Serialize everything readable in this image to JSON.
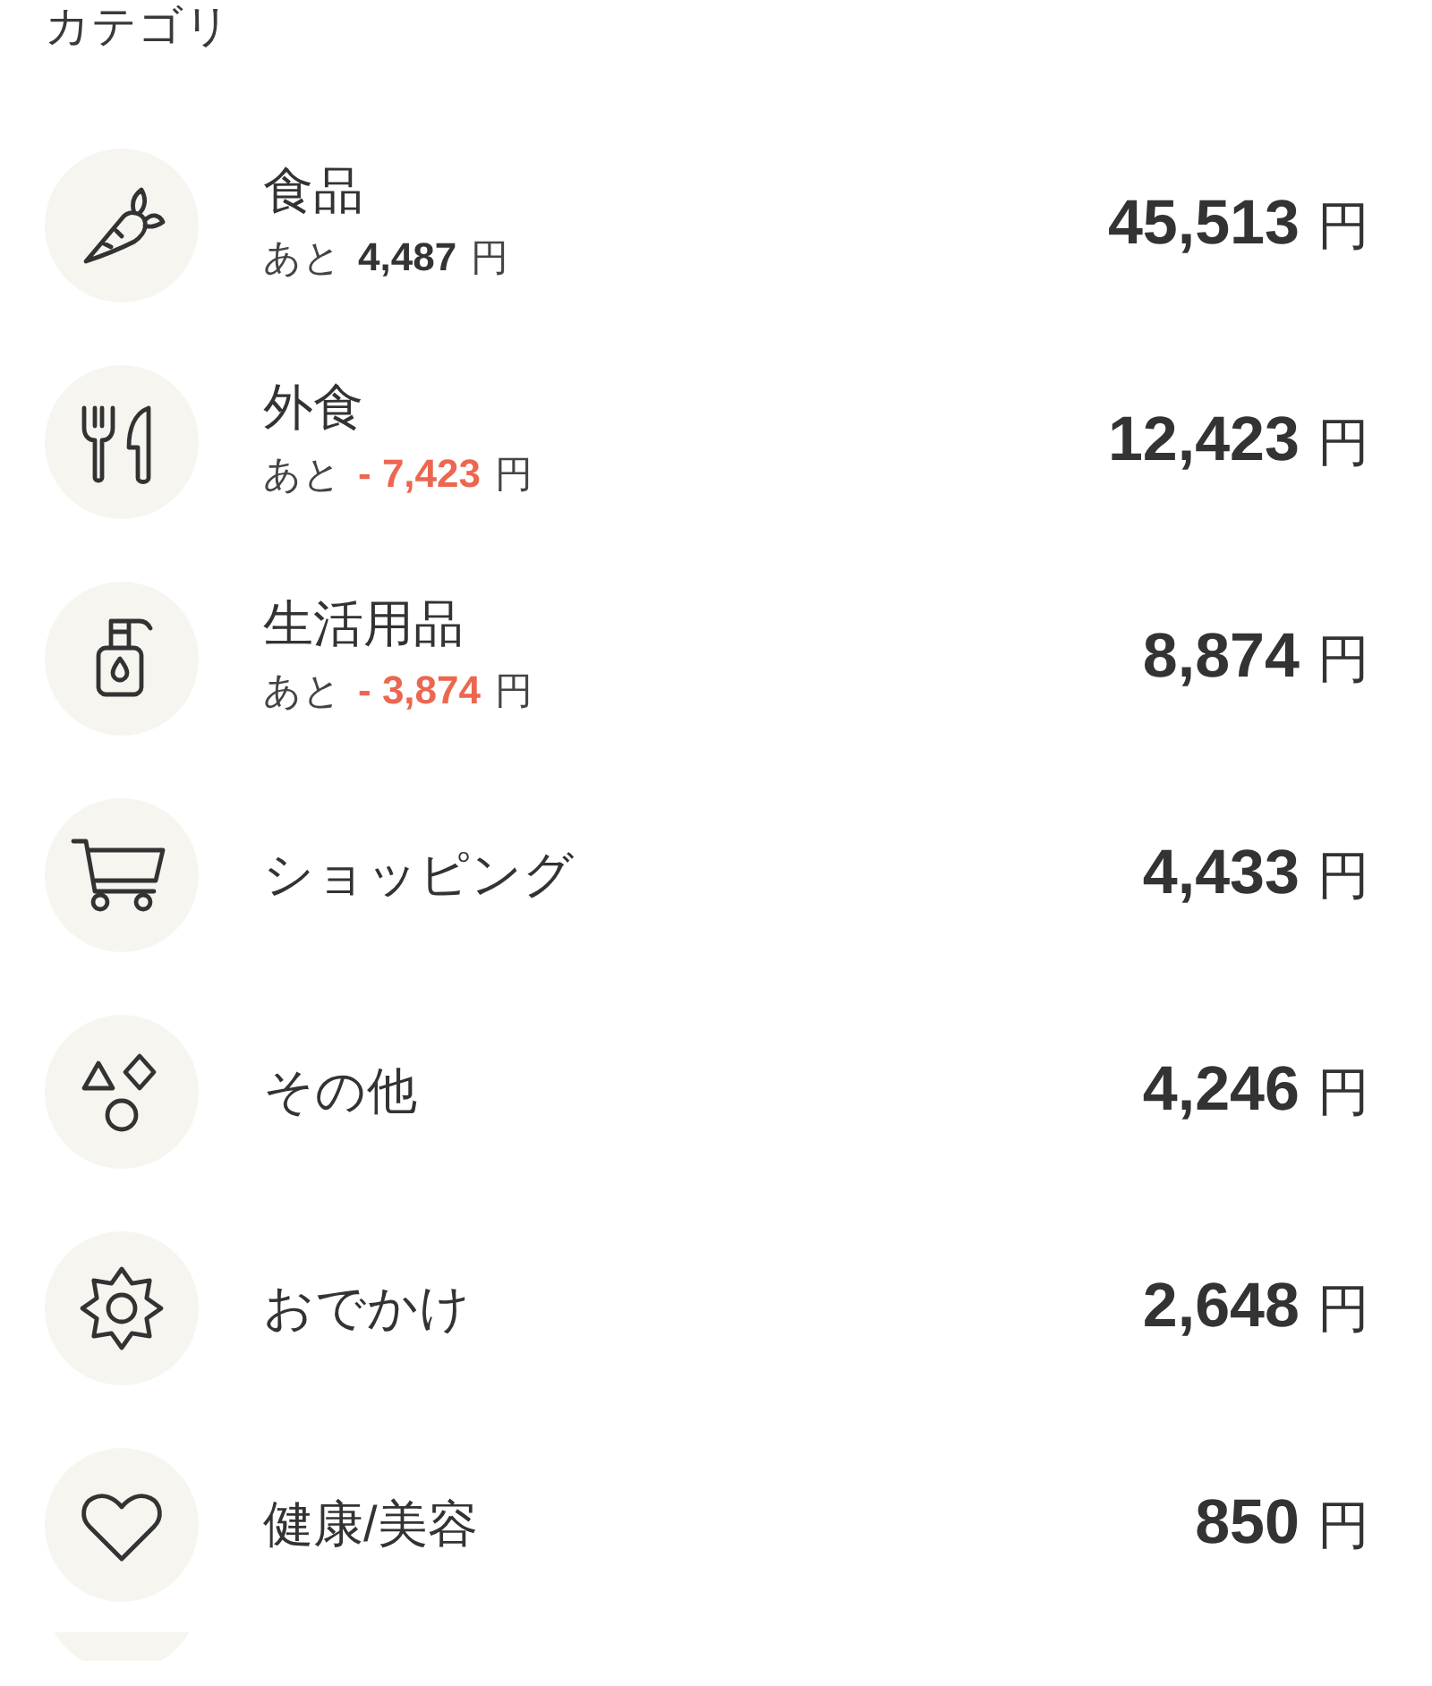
{
  "header": {
    "title": "カテゴリ"
  },
  "categories": [
    {
      "name": "食品",
      "amount": "45,513",
      "unit": "円",
      "remaining": {
        "label": "あと",
        "amount": "4,487",
        "unit": "円",
        "over": false
      }
    },
    {
      "name": "外食",
      "amount": "12,423",
      "unit": "円",
      "remaining": {
        "label": "あと",
        "amount": "- 7,423",
        "unit": "円",
        "over": true
      }
    },
    {
      "name": "生活用品",
      "amount": "8,874",
      "unit": "円",
      "remaining": {
        "label": "あと",
        "amount": "- 3,874",
        "unit": "円",
        "over": true
      }
    },
    {
      "name": "ショッピング",
      "amount": "4,433",
      "unit": "円"
    },
    {
      "name": "その他",
      "amount": "4,246",
      "unit": "円"
    },
    {
      "name": "おでかけ",
      "amount": "2,648",
      "unit": "円"
    },
    {
      "name": "健康/美容",
      "amount": "850",
      "unit": "円"
    }
  ]
}
